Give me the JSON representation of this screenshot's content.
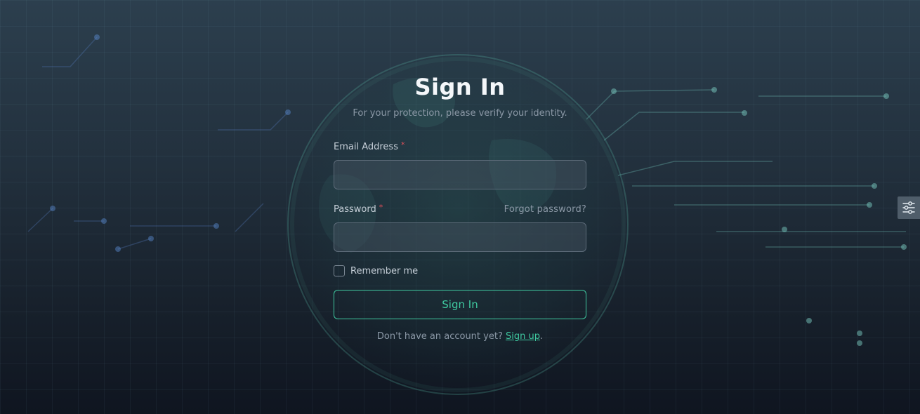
{
  "header": {
    "title": "Sign In",
    "subtitle": "For your protection, please verify your identity."
  },
  "form": {
    "email_label": "Email Address",
    "email_value": "",
    "required_mark": "*",
    "password_label": "Password",
    "password_value": "",
    "forgot_password": "Forgot password?",
    "remember_label": "Remember me",
    "remember_checked": false,
    "submit_label": "Sign In"
  },
  "footer": {
    "prompt": "Don't have an account yet?",
    "signup_link": "Sign up",
    "trailing": "."
  },
  "settings": {
    "icon": "sliders-icon"
  },
  "colors": {
    "accent": "#3fc9a0",
    "required": "#e0505a",
    "background_top": "#2c3f4e",
    "background_bottom": "#0f1520"
  }
}
